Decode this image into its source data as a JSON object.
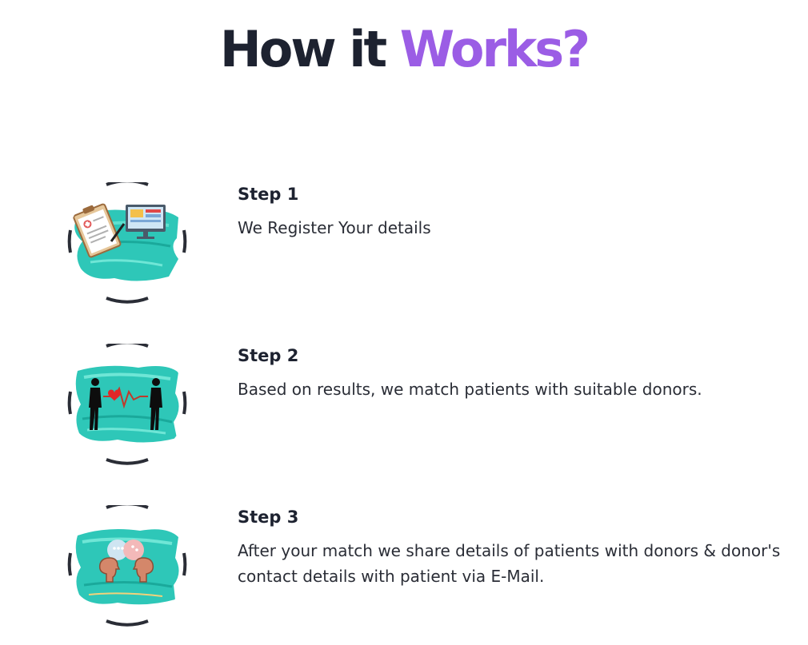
{
  "heading": {
    "part1": "How it",
    "part2": "Works?",
    "accent_color": "#9b5de5"
  },
  "steps": [
    {
      "title": "Step 1",
      "description": "We Register Your details",
      "icon": "registration-clipboard-monitor-icon"
    },
    {
      "title": "Step 2",
      "description": "Based on results, we match patients with suitable donors.",
      "icon": "heartbeat-match-icon"
    },
    {
      "title": "Step 3",
      "description": "After your match we share details of patients with donors & donor's contact details with patient via E-Mail.",
      "icon": "conversation-heads-icon"
    }
  ]
}
